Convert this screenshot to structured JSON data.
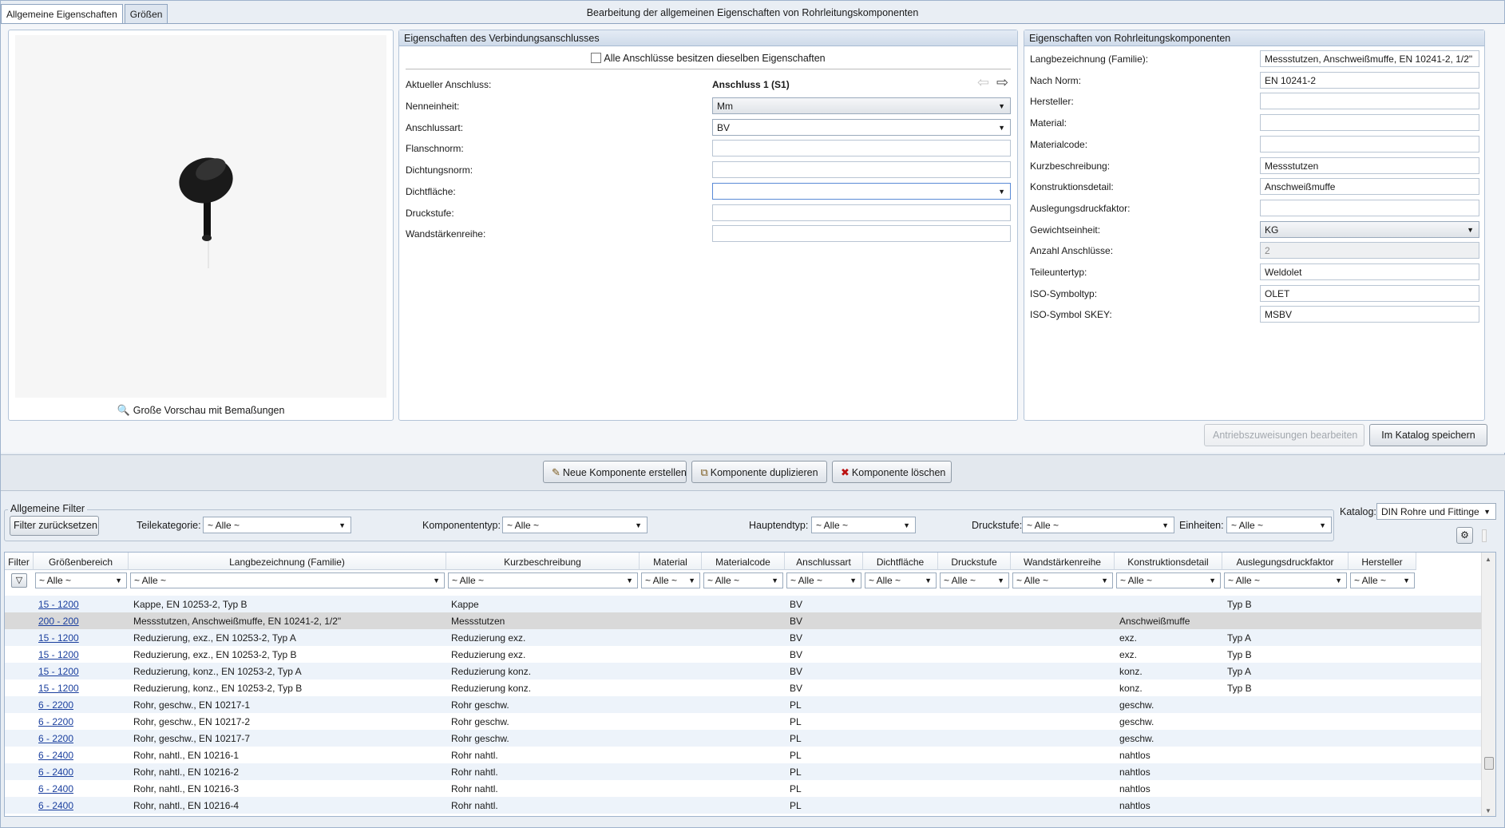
{
  "window_title": "Bearbeitung der allgemeinen Eigenschaften von Rohrleitungskomponenten",
  "tabs": [
    "Allgemeine Eigenschaften",
    "Größen"
  ],
  "preview": {
    "link_label": "Große Vorschau mit Bemaßungen"
  },
  "connection": {
    "header": "Eigenschaften des Verbindungsanschlusses",
    "same_props_label": "Alle Anschlüsse besitzen dieselben Eigenschaften",
    "current_label": "Aktueller Anschluss:",
    "current_value": "Anschluss 1 (S1)",
    "fields": [
      {
        "label": "Nenneinheit:",
        "value": "Mm",
        "type": "combo-grad"
      },
      {
        "label": "Anschlussart:",
        "value": "BV",
        "type": "combo"
      },
      {
        "label": "Flanschnorm:",
        "value": "",
        "type": "text"
      },
      {
        "label": "Dichtungsnorm:",
        "value": "",
        "type": "text"
      },
      {
        "label": "Dichtfläche:",
        "value": "",
        "type": "combo-focus"
      },
      {
        "label": "Druckstufe:",
        "value": "",
        "type": "text"
      },
      {
        "label": "Wandstärkenreihe:",
        "value": "",
        "type": "text"
      }
    ]
  },
  "properties": {
    "header": "Eigenschaften von Rohrleitungskomponenten",
    "fields": [
      {
        "label": "Langbezeichnung (Familie):",
        "value": "Messstutzen, Anschweißmuffe, EN 10241-2, 1/2\"",
        "type": "text"
      },
      {
        "label": "Nach Norm:",
        "value": "EN 10241-2",
        "type": "text"
      },
      {
        "label": "Hersteller:",
        "value": "",
        "type": "text"
      },
      {
        "label": "Material:",
        "value": "",
        "type": "text"
      },
      {
        "label": "Materialcode:",
        "value": "",
        "type": "text"
      },
      {
        "label": "Kurzbeschreibung:",
        "value": "Messstutzen",
        "type": "text"
      },
      {
        "label": "Konstruktionsdetail:",
        "value": "Anschweißmuffe",
        "type": "text"
      },
      {
        "label": "Auslegungsdruckfaktor:",
        "value": "",
        "type": "text"
      },
      {
        "label": "Gewichtseinheit:",
        "value": "KG",
        "type": "combo-grad"
      },
      {
        "label": "Anzahl Anschlüsse:",
        "value": "2",
        "type": "readonly"
      },
      {
        "label": "Teileuntertyp:",
        "value": "Weldolet",
        "type": "text"
      },
      {
        "label": "ISO-Symboltyp:",
        "value": "OLET",
        "type": "text"
      },
      {
        "label": "ISO-Symbol SKEY:",
        "value": "MSBV",
        "type": "text"
      }
    ]
  },
  "buttons": {
    "drive_assign": "Antriebszuweisungen bearbeiten",
    "save_catalog": "Im Katalog speichern",
    "new_component": "Neue Komponente erstellen",
    "duplicate_component": "Komponente duplizieren",
    "delete_component": "Komponente löschen",
    "reset_filter": "Filter zurücksetzen"
  },
  "filters": {
    "legend": "Allgemeine Filter",
    "teilekategorie_label": "Teilekategorie:",
    "komponententyp_label": "Komponententyp:",
    "hauptendtyp_label": "Hauptendtyp:",
    "druckstufe_label": "Druckstufe:",
    "einheiten_label": "Einheiten:",
    "all_value": "~ Alle ~",
    "katalog_label": "Katalog:",
    "katalog_value": "DIN Rohre und Fittinge"
  },
  "grid": {
    "columns": [
      "Filter",
      "Größenbereich",
      "Langbezeichnung (Familie)",
      "Kurzbeschreibung",
      "Material",
      "Materialcode",
      "Anschlussart",
      "Dichtfläche",
      "Druckstufe",
      "Wandstärkenreihe",
      "Konstruktionsdetail",
      "Auslegungsdruckfaktor",
      "Hersteller"
    ],
    "filter_value": "~ Alle ~",
    "rows": [
      {
        "size": "15 - 1200",
        "name": "Kappe, EN 10253-2, Typ B",
        "short": "Kappe",
        "conn": "BV",
        "detail": "",
        "factor": "Typ B"
      },
      {
        "size": "200 - 200",
        "name": "Messstutzen, Anschweißmuffe, EN 10241-2, 1/2\"",
        "short": "Messstutzen",
        "conn": "BV",
        "detail": "Anschweißmuffe",
        "factor": ""
      },
      {
        "size": "15 - 1200",
        "name": "Reduzierung, exz., EN 10253-2, Typ A",
        "short": "Reduzierung exz.",
        "conn": "BV",
        "detail": "exz.",
        "factor": "Typ A"
      },
      {
        "size": "15 - 1200",
        "name": "Reduzierung, exz., EN 10253-2, Typ B",
        "short": "Reduzierung exz.",
        "conn": "BV",
        "detail": "exz.",
        "factor": "Typ B"
      },
      {
        "size": "15 - 1200",
        "name": "Reduzierung, konz., EN 10253-2, Typ A",
        "short": "Reduzierung konz.",
        "conn": "BV",
        "detail": "konz.",
        "factor": "Typ A"
      },
      {
        "size": "15 - 1200",
        "name": "Reduzierung, konz., EN 10253-2, Typ B",
        "short": "Reduzierung konz.",
        "conn": "BV",
        "detail": "konz.",
        "factor": "Typ B"
      },
      {
        "size": "6 - 2200",
        "name": "Rohr, geschw., EN 10217-1",
        "short": "Rohr geschw.",
        "conn": "PL",
        "detail": "geschw.",
        "factor": ""
      },
      {
        "size": "6 - 2200",
        "name": "Rohr, geschw., EN 10217-2",
        "short": "Rohr geschw.",
        "conn": "PL",
        "detail": "geschw.",
        "factor": ""
      },
      {
        "size": "6 - 2200",
        "name": "Rohr, geschw., EN 10217-7",
        "short": "Rohr geschw.",
        "conn": "PL",
        "detail": "geschw.",
        "factor": ""
      },
      {
        "size": "6 - 2400",
        "name": "Rohr, nahtl., EN 10216-1",
        "short": "Rohr nahtl.",
        "conn": "PL",
        "detail": "nahtlos",
        "factor": ""
      },
      {
        "size": "6 - 2400",
        "name": "Rohr, nahtl., EN 10216-2",
        "short": "Rohr nahtl.",
        "conn": "PL",
        "detail": "nahtlos",
        "factor": ""
      },
      {
        "size": "6 - 2400",
        "name": "Rohr, nahtl., EN 10216-3",
        "short": "Rohr nahtl.",
        "conn": "PL",
        "detail": "nahtlos",
        "factor": ""
      },
      {
        "size": "6 - 2400",
        "name": "Rohr, nahtl., EN 10216-4",
        "short": "Rohr nahtl.",
        "conn": "PL",
        "detail": "nahtlos",
        "factor": ""
      }
    ]
  }
}
